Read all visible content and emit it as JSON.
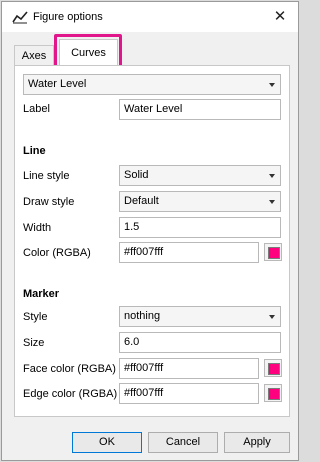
{
  "window": {
    "title": "Figure options",
    "icon": "chart-line-icon",
    "close_label": "✕"
  },
  "tabs": [
    {
      "label": "Axes",
      "selected": false
    },
    {
      "label": "Curves",
      "selected": true,
      "highlighted": true
    }
  ],
  "highlight_color": "#e0168a",
  "curve_selector": {
    "value": "Water Level"
  },
  "label_field": {
    "label": "Label",
    "value": "Water Level"
  },
  "line": {
    "heading": "Line",
    "line_style": {
      "label": "Line style",
      "value": "Solid"
    },
    "draw_style": {
      "label": "Draw style",
      "value": "Default"
    },
    "width": {
      "label": "Width",
      "value": "1.5"
    },
    "color": {
      "label": "Color (RGBA)",
      "value": "#ff007fff",
      "swatch": "#ff007f"
    }
  },
  "marker": {
    "heading": "Marker",
    "style": {
      "label": "Style",
      "value": "nothing"
    },
    "size": {
      "label": "Size",
      "value": "6.0"
    },
    "face_color": {
      "label": "Face color (RGBA)",
      "value": "#ff007fff",
      "swatch": "#ff007f"
    },
    "edge_color": {
      "label": "Edge color (RGBA)",
      "value": "#ff007fff",
      "swatch": "#ff007f"
    }
  },
  "buttons": {
    "ok": "OK",
    "cancel": "Cancel",
    "apply": "Apply"
  }
}
